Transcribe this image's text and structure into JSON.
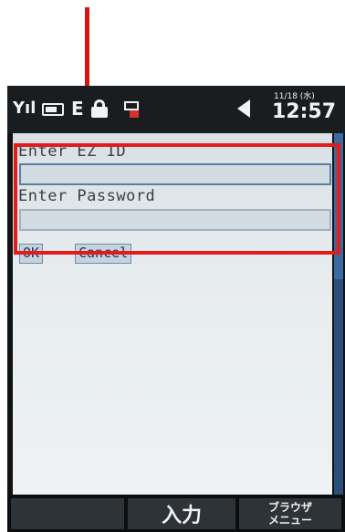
{
  "status_bar": {
    "signal_icon": "antenna-signal-icon",
    "battery_icon": "battery-icon",
    "ez_icon": "ez-web-icon",
    "lock_icon": "lock-icon",
    "mail_icon": "mail-notification-icon",
    "back_icon": "triangle-left-icon",
    "date": "11/18 (水)",
    "time": "12:57"
  },
  "form": {
    "ez_id_label": "Enter EZ ID",
    "ez_id_value": "",
    "password_label": "Enter Password",
    "password_value": "",
    "ok_label": "OK",
    "cancel_label": "Cancel"
  },
  "softkeys": {
    "left": "",
    "center": "入力",
    "right_line1": "ブラウザ",
    "right_line2": "メニュー"
  },
  "colors": {
    "annotation": "#e31b1b",
    "field_border": "#5b7fa3"
  }
}
